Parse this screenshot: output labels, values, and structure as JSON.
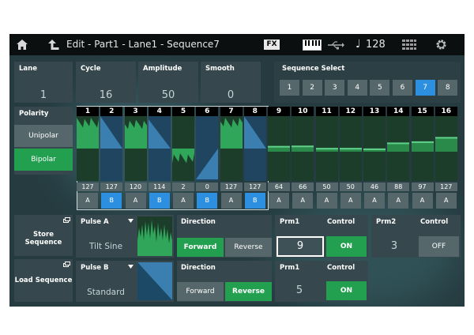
{
  "header": {
    "home_icon": "home-icon",
    "back_icon": "back-arrow-icon",
    "title": "Edit - Part1 - Lane1 - Sequence7",
    "fx_label": "FX",
    "keyboard_icon": "keyboard-icon",
    "usb_icon": "usb-icon",
    "note_icon": "♩",
    "tempo": "128",
    "grid_icon": "grid-icon",
    "settings_icon": "gear-icon"
  },
  "lane": {
    "label": "Lane",
    "value": "1"
  },
  "cycle": {
    "label": "Cycle",
    "value": "16"
  },
  "amplitude": {
    "label": "Amplitude",
    "value": "50"
  },
  "smooth": {
    "label": "Smooth",
    "value": "0"
  },
  "sequence_select": {
    "label": "Sequence Select",
    "items": [
      "1",
      "2",
      "3",
      "4",
      "5",
      "6",
      "7",
      "8"
    ],
    "selected": "7"
  },
  "polarity": {
    "label": "Polarity",
    "options": [
      "Unipolar",
      "Bipolar"
    ],
    "selected": "Bipolar"
  },
  "steps": [
    {
      "num": "1",
      "amp": "127",
      "type": "A",
      "level": 1.0,
      "shape": "noise"
    },
    {
      "num": "2",
      "amp": "127",
      "type": "B",
      "level": 1.0,
      "shape": "ramp-down"
    },
    {
      "num": "3",
      "amp": "120",
      "type": "A",
      "level": 0.94,
      "shape": "noise"
    },
    {
      "num": "4",
      "amp": "114",
      "type": "B",
      "level": 0.9,
      "shape": "ramp-down"
    },
    {
      "num": "5",
      "amp": "2",
      "type": "A",
      "level": 0.02,
      "shape": "noise"
    },
    {
      "num": "6",
      "amp": "0",
      "type": "B",
      "level": 0.0,
      "shape": "ramp-up"
    },
    {
      "num": "7",
      "amp": "127",
      "type": "A",
      "level": 1.0,
      "shape": "noise"
    },
    {
      "num": "8",
      "amp": "127",
      "type": "B",
      "level": 1.0,
      "shape": "ramp-down"
    },
    {
      "num": "9",
      "amp": "64",
      "type": "A",
      "level": 0.5,
      "shape": "flat"
    },
    {
      "num": "10",
      "amp": "66",
      "type": "A",
      "level": 0.52,
      "shape": "flat"
    },
    {
      "num": "11",
      "amp": "50",
      "type": "A",
      "level": 0.39,
      "shape": "flat"
    },
    {
      "num": "12",
      "amp": "50",
      "type": "A",
      "level": 0.39,
      "shape": "flat"
    },
    {
      "num": "13",
      "amp": "46",
      "type": "A",
      "level": 0.36,
      "shape": "flat"
    },
    {
      "num": "14",
      "amp": "88",
      "type": "A",
      "level": 0.69,
      "shape": "flat"
    },
    {
      "num": "15",
      "amp": "97",
      "type": "A",
      "level": 0.76,
      "shape": "flat"
    },
    {
      "num": "16",
      "amp": "127",
      "type": "A",
      "level": 1.0,
      "shape": "flat"
    }
  ],
  "store_sequence": {
    "label": "Store Sequence"
  },
  "load_sequence": {
    "label": "Load Sequence"
  },
  "pulse_a": {
    "label": "Pulse A",
    "value": "Tilt Sine",
    "direction_label": "Direction",
    "directions": [
      "Forward",
      "Reverse"
    ],
    "direction_selected": "Forward",
    "prm1_label": "Prm1",
    "prm1_value": "9",
    "control1_label": "Control",
    "control1_value": "ON",
    "prm2_label": "Prm2",
    "prm2_value": "3",
    "control2_label": "Control",
    "control2_value": "OFF"
  },
  "pulse_b": {
    "label": "Pulse B",
    "value": "Standard",
    "direction_label": "Direction",
    "directions": [
      "Forward",
      "Reverse"
    ],
    "direction_selected": "Reverse",
    "prm1_label": "Prm1",
    "prm1_value": "5",
    "control1_label": "Control",
    "control1_value": "ON"
  },
  "colors": {
    "accent_green": "#22a050",
    "accent_blue": "#2d8fe0",
    "panel": "#36484d",
    "button": "#56676b"
  }
}
